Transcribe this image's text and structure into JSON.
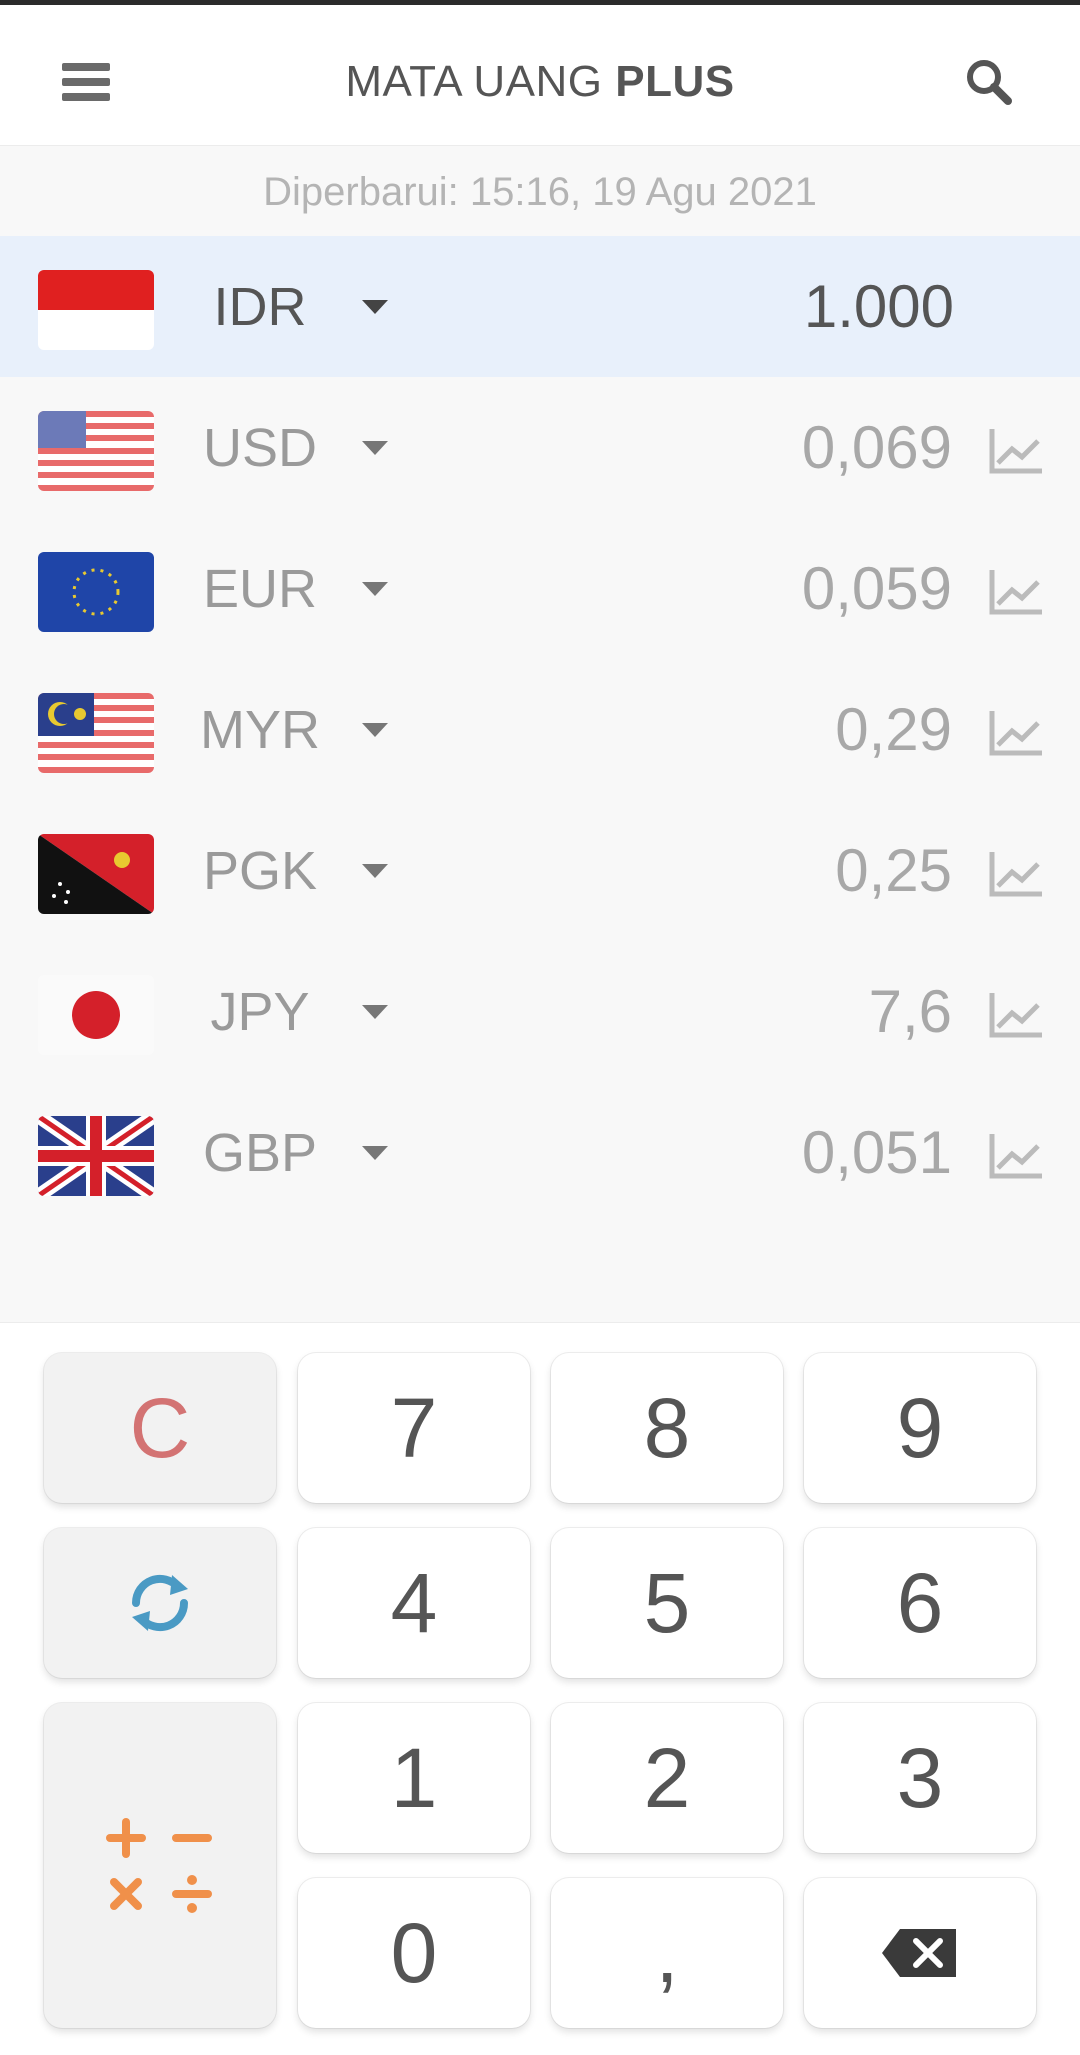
{
  "app": {
    "title_prefix": "MATA UANG ",
    "title_bold": "PLUS",
    "updated_text": "Diperbarui: 15:16, 19 Agu 2021"
  },
  "currencies": [
    {
      "code": "IDR",
      "value": "1.000",
      "flag": "indonesia-flag-icon"
    },
    {
      "code": "USD",
      "value": "0,069",
      "flag": "usa-flag-icon"
    },
    {
      "code": "EUR",
      "value": "0,059",
      "flag": "eu-flag-icon"
    },
    {
      "code": "MYR",
      "value": "0,29",
      "flag": "malaysia-flag-icon"
    },
    {
      "code": "PGK",
      "value": "0,25",
      "flag": "png-flag-icon"
    },
    {
      "code": "JPY",
      "value": "7,6",
      "flag": "japan-flag-icon"
    },
    {
      "code": "GBP",
      "value": "0,051",
      "flag": "uk-flag-icon"
    }
  ],
  "keypad": {
    "clear": "C",
    "k7": "7",
    "k8": "8",
    "k9": "9",
    "k4": "4",
    "k5": "5",
    "k6": "6",
    "k1": "1",
    "k2": "2",
    "k3": "3",
    "k0": "0",
    "comma": ","
  },
  "colors": {
    "clear_red": "#d37373",
    "refresh_blue": "#4a9ac4",
    "ops_orange": "#f0904a",
    "base_row_bg": "#e8f0fb"
  }
}
